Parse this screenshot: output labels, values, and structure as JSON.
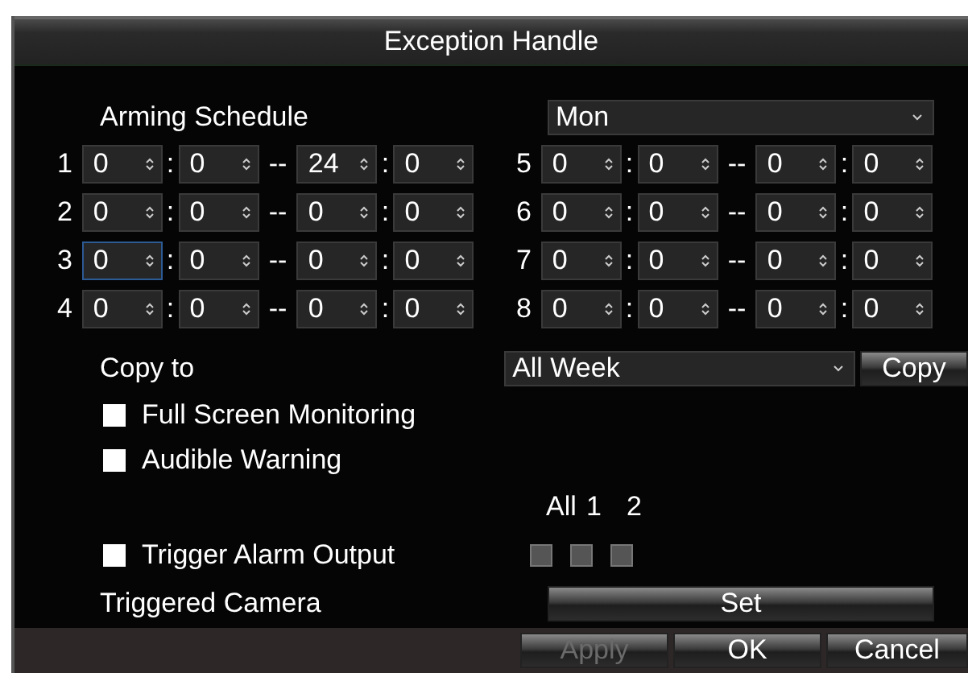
{
  "window": {
    "title": "Exception Handle"
  },
  "arming_schedule": {
    "label": "Arming Schedule",
    "value": "Mon"
  },
  "periods": [
    {
      "label": "1",
      "fields": [
        {
          "value": "0",
          "focused": false
        },
        {
          "value": "0",
          "focused": false
        },
        {
          "value": "24",
          "focused": false
        },
        {
          "value": "0",
          "focused": false
        }
      ]
    },
    {
      "label": "2",
      "fields": [
        {
          "value": "0",
          "focused": false
        },
        {
          "value": "0",
          "focused": false
        },
        {
          "value": "0",
          "focused": false
        },
        {
          "value": "0",
          "focused": false
        }
      ]
    },
    {
      "label": "3",
      "fields": [
        {
          "value": "0",
          "focused": true
        },
        {
          "value": "0",
          "focused": false
        },
        {
          "value": "0",
          "focused": false
        },
        {
          "value": "0",
          "focused": false
        }
      ]
    },
    {
      "label": "4",
      "fields": [
        {
          "value": "0",
          "focused": false
        },
        {
          "value": "0",
          "focused": false
        },
        {
          "value": "0",
          "focused": false
        },
        {
          "value": "0",
          "focused": false
        }
      ]
    },
    {
      "label": "5",
      "fields": [
        {
          "value": "0",
          "focused": false
        },
        {
          "value": "0",
          "focused": false
        },
        {
          "value": "0",
          "focused": false
        },
        {
          "value": "0",
          "focused": false
        }
      ]
    },
    {
      "label": "6",
      "fields": [
        {
          "value": "0",
          "focused": false
        },
        {
          "value": "0",
          "focused": false
        },
        {
          "value": "0",
          "focused": false
        },
        {
          "value": "0",
          "focused": false
        }
      ]
    },
    {
      "label": "7",
      "fields": [
        {
          "value": "0",
          "focused": false
        },
        {
          "value": "0",
          "focused": false
        },
        {
          "value": "0",
          "focused": false
        },
        {
          "value": "0",
          "focused": false
        }
      ]
    },
    {
      "label": "8",
      "fields": [
        {
          "value": "0",
          "focused": false
        },
        {
          "value": "0",
          "focused": false
        },
        {
          "value": "0",
          "focused": false
        },
        {
          "value": "0",
          "focused": false
        }
      ]
    }
  ],
  "time_separator": ":",
  "range_separator": "--",
  "copy_to": {
    "label": "Copy to",
    "value": "All Week",
    "button": "Copy"
  },
  "options": [
    {
      "label": "Full Screen Monitoring",
      "checked": false
    },
    {
      "label": "Audible Warning",
      "checked": false
    }
  ],
  "trigger_alarm_output": {
    "label": "Trigger Alarm Output",
    "checked": false,
    "outputs": [
      {
        "label": "All",
        "checked": false
      },
      {
        "label": "1",
        "checked": false
      },
      {
        "label": "2",
        "checked": false
      }
    ]
  },
  "triggered_camera": {
    "label": "Triggered Camera",
    "button": "Set"
  },
  "buttons": [
    {
      "label": "Apply",
      "disabled": true
    },
    {
      "label": "OK",
      "disabled": false
    },
    {
      "label": "Cancel",
      "disabled": false
    }
  ]
}
